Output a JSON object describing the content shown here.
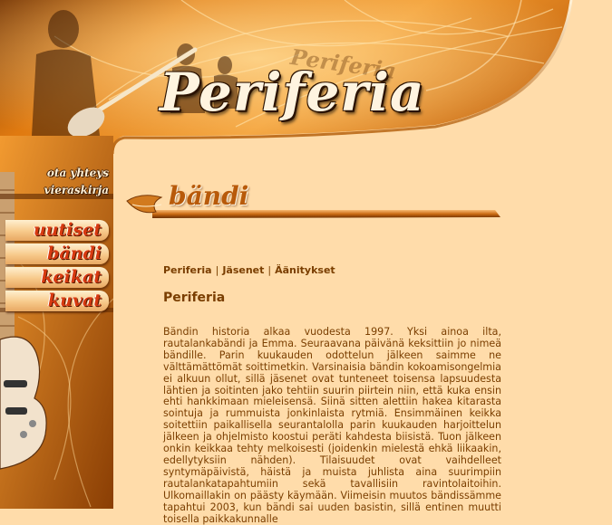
{
  "site": {
    "logo": "Periferia",
    "logo_ghost": "Periferia"
  },
  "nav": {
    "top_links": [
      {
        "label": "ota yhteys"
      },
      {
        "label": "vieraskirja"
      }
    ],
    "items": [
      {
        "label": "uutiset"
      },
      {
        "label": "bändi"
      },
      {
        "label": "keikat"
      },
      {
        "label": "kuvat"
      }
    ]
  },
  "section": {
    "title": "bändi"
  },
  "subnav": [
    "Periferia",
    "Jäsenet",
    "Äänitykset"
  ],
  "main": {
    "title": "Periferia",
    "body": "Bändin historia alkaa vuodesta 1997. Yksi ainoa ilta, rautalankabändi ja Emma. Seuraavana päivänä keksittiin jo nimeä bändille. Parin kuukauden odottelun jälkeen saimme ne välttämättömät soittimetkin. Varsinaisia bändin kokoamisongelmia ei alkuun ollut, sillä jäsenet ovat tunteneet toisensa lapsuudesta lähtien ja soitinten jako tehtiin suurin piirtein niin, että kuka ensin ehti hankkimaan mieleisensä. Siinä sitten alettiin hakea kitarasta sointuja ja rummuista jonkinlaista rytmiä. Ensimmäinen keikka soitettiin paikallisella seurantalolla parin kuukauden harjoittelun jälkeen ja ohjelmisto koostui peräti kahdesta biisistä. Tuon jälkeen onkin keikkaa tehty melkoisesti (joidenkin mielestä ehkä liikaakin, edellytyksiin nähden). Tilaisuudet ovat vaihdelleet syntymäpäivistä, häistä ja muista juhlista aina suurimpiin rautalankatapahtumiin sekä tavallisiin ravintolaitoihin. Ulkomaillakin on päästy käymään. Viimeisin muutos bändissämme tapahtui 2003, kun bändi sai uuden basistin, sillä entinen muutti toisella paikkakunnalle"
  },
  "colors": {
    "background": "#ffdcaa",
    "text": "#7a3e00",
    "nav_text": "#d83a10",
    "accent": "#e07a10"
  }
}
